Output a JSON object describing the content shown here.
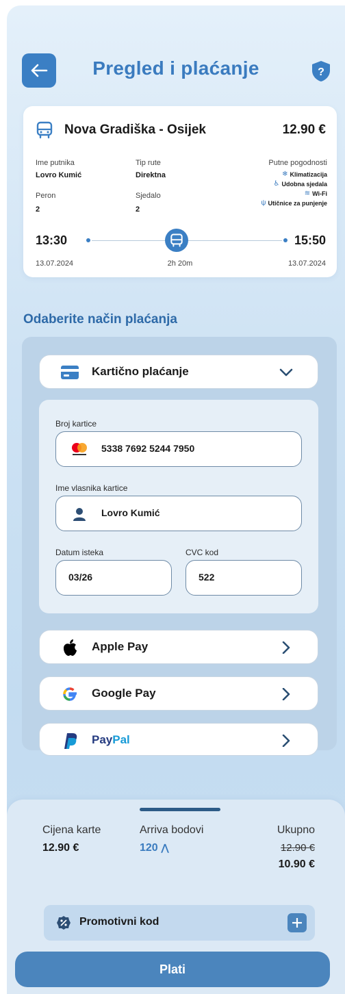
{
  "header": {
    "title": "Pregled i plaćanje"
  },
  "trip": {
    "route": "Nova Gradiška - Osijek",
    "price": "12.90 €",
    "passenger_label": "Ime putnika",
    "passenger_value": "Lovro Kumić",
    "route_type_label": "Tip rute",
    "route_type_value": "Direktna",
    "platform_label": "Peron",
    "platform_value": "2",
    "seat_label": "Sjedalo",
    "seat_value": "2",
    "amenities_label": "Putne pogodnosti",
    "amenities": [
      {
        "label": "Klimatizacija",
        "icon": "snowflake-icon"
      },
      {
        "label": "Udobna sjedala",
        "icon": "seat-icon"
      },
      {
        "label": "Wi-Fi",
        "icon": "wifi-icon"
      },
      {
        "label": "Utičnice za punjenje",
        "icon": "usb-icon"
      }
    ],
    "departure_time": "13:30",
    "departure_date": "13.07.2024",
    "arrival_time": "15:50",
    "arrival_date": "13.07.2024",
    "duration": "2h 20m"
  },
  "payment": {
    "section_title": "Odaberite način plaćanja",
    "card_method_label": "Kartično plaćanje",
    "card_number_label": "Broj kartice",
    "card_number_value": "5338 7692 5244 7950",
    "card_holder_label": "Ime vlasnika kartice",
    "card_holder_value": "Lovro Kumić",
    "expiry_label": "Datum isteka",
    "expiry_value": "03/26",
    "cvc_label": "CVC kod",
    "cvc_value": "522",
    "apple_pay_label": "Apple Pay",
    "google_pay_label": "Google Pay",
    "paypal_label_part1": "Pay",
    "paypal_label_part2": "Pal"
  },
  "summary": {
    "ticket_price_label": "Cijena karte",
    "ticket_price_value": "12.90 €",
    "points_label": "Arriva bodovi",
    "points_value": "120",
    "total_label": "Ukupno",
    "total_old": "12.90 €",
    "total_new": "10.90 €",
    "promo_label": "Promotivni kod",
    "pay_button": "Plati"
  },
  "colors": {
    "accent": "#3b7fc4",
    "title": "#3a7bbf",
    "points": "#3a7bbf"
  }
}
